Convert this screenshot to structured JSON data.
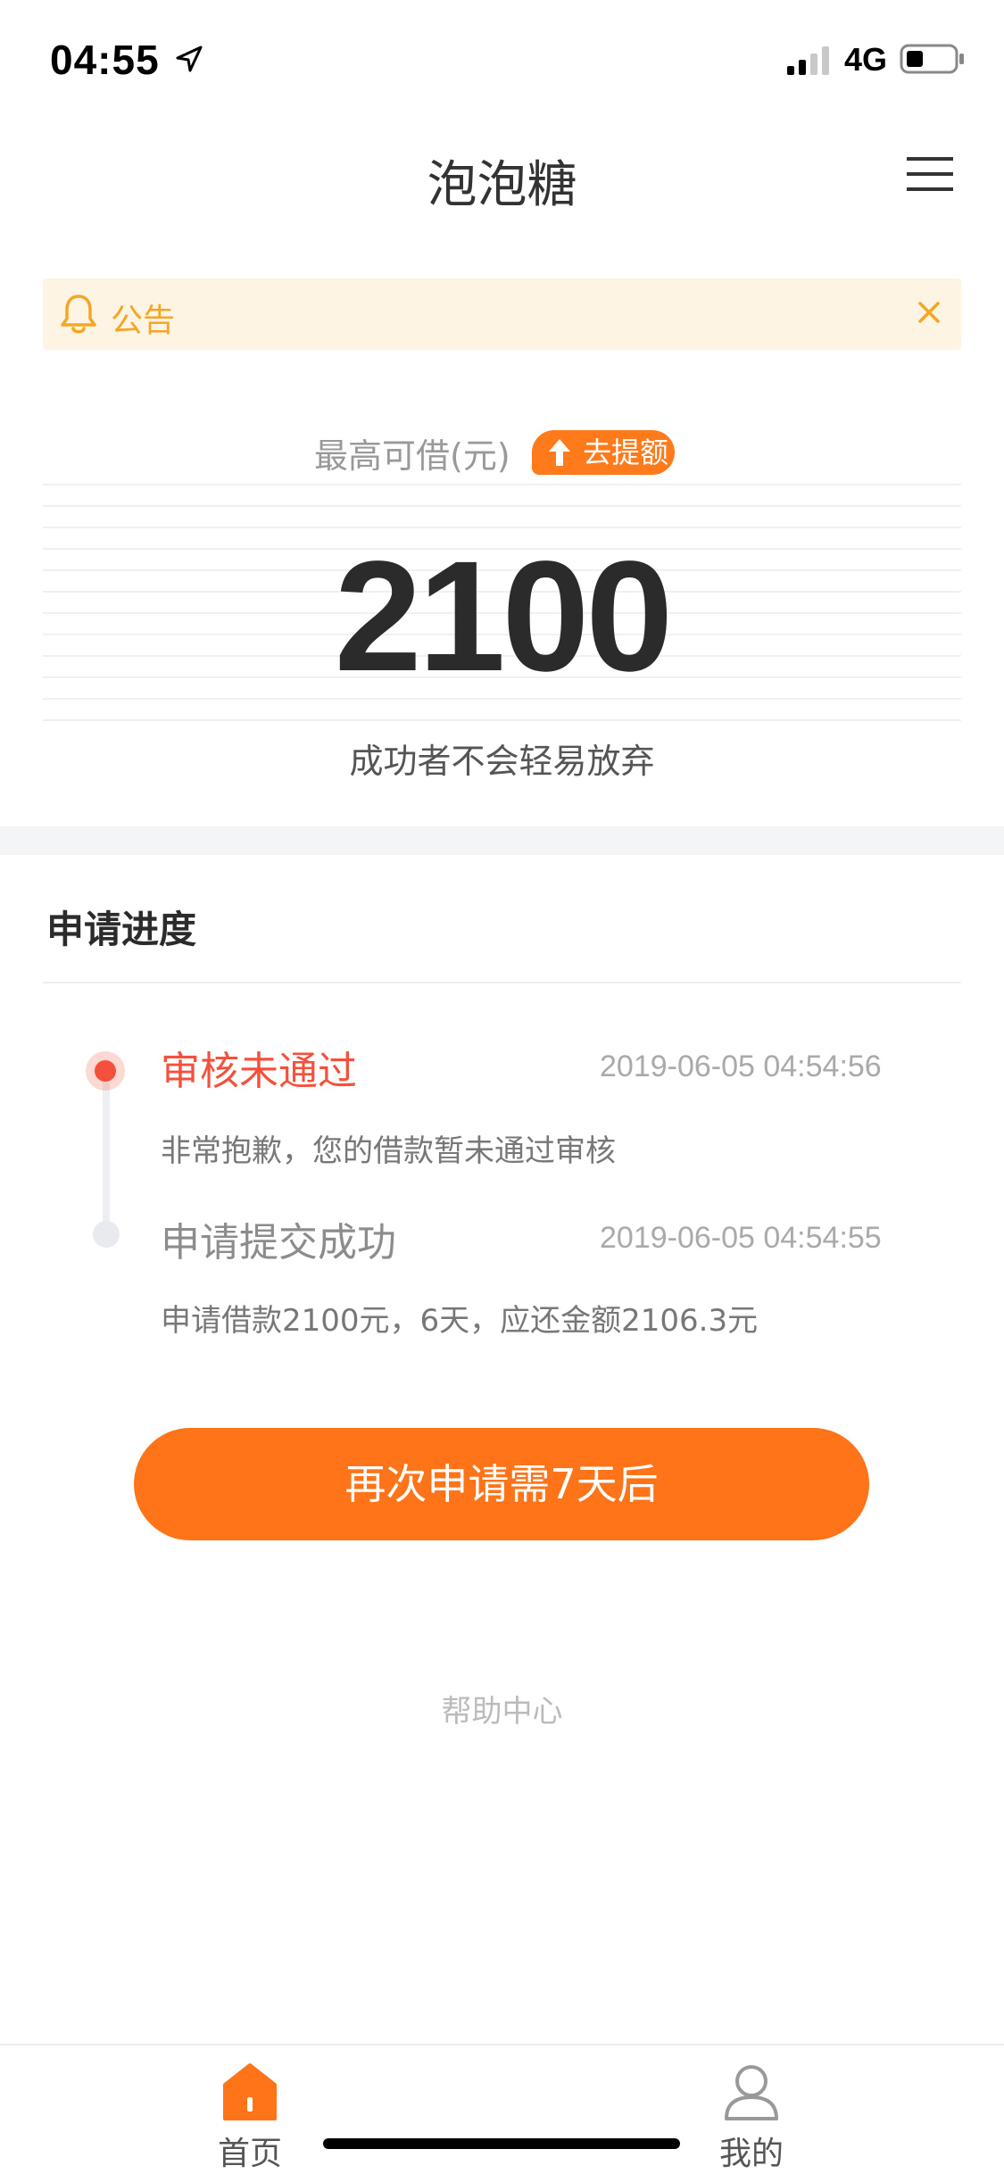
{
  "status_bar": {
    "time": "04:55",
    "network": "4G",
    "icons": [
      "location-arrow-icon",
      "signal-icon",
      "battery-icon"
    ]
  },
  "header": {
    "title": "泡泡糖",
    "menu_icon": "menu-icon"
  },
  "notice": {
    "label": "公告",
    "icon": "bell-icon",
    "close_icon": "close-icon",
    "color": "#F5A623",
    "background": "#FEF4E4"
  },
  "credit": {
    "label": "最高可借(元)",
    "raise_button": "去提额",
    "amount": "2100",
    "slogan": "成功者不会轻易放弃"
  },
  "progress": {
    "title": "申请进度",
    "steps": [
      {
        "status": "审核未通过",
        "time": "2019-06-05 04:54:56",
        "description": "非常抱歉，您的借款暂未通过审核",
        "active": true
      },
      {
        "status": "申请提交成功",
        "time": "2019-06-05 04:54:55",
        "description": "申请借款2100元，6天，应还金额2106.3元",
        "active": false
      }
    ]
  },
  "action": {
    "reapply_label": "再次申请需7天后"
  },
  "help": {
    "label": "帮助中心"
  },
  "tab_bar": {
    "tabs": [
      {
        "label": "首页",
        "icon": "home-icon",
        "selected": true
      },
      {
        "label": "我的",
        "icon": "user-icon",
        "selected": false
      }
    ]
  },
  "colors": {
    "accent": "#FF7418",
    "error": "#F5503C",
    "notice": "#F5A623"
  }
}
